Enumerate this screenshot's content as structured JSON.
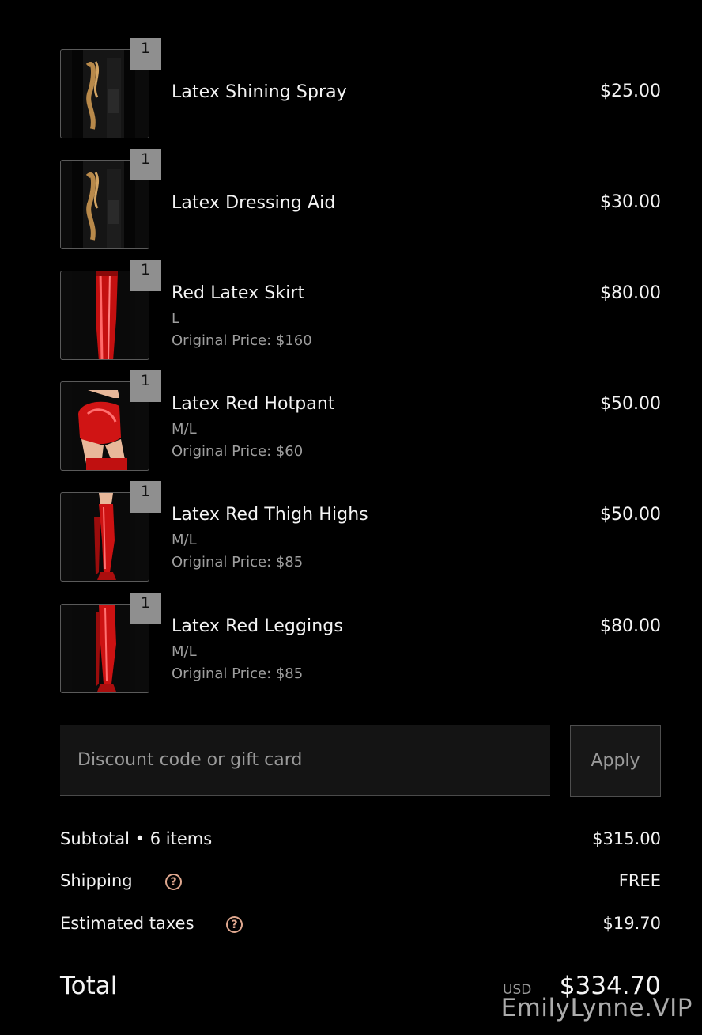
{
  "items": [
    {
      "name": "Latex Shining Spray",
      "qty": "1",
      "price": "$25.00",
      "variant": "",
      "original": "",
      "image": "spray-bottle"
    },
    {
      "name": "Latex Dressing Aid",
      "qty": "1",
      "price": "$30.00",
      "variant": "",
      "original": "",
      "image": "spray-bottle"
    },
    {
      "name": "Red Latex Skirt",
      "qty": "1",
      "price": "$80.00",
      "variant": "L",
      "original": "Original Price: $160",
      "image": "red-skirt"
    },
    {
      "name": "Latex Red Hotpant",
      "qty": "1",
      "price": "$50.00",
      "variant": "M/L",
      "original": "Original Price: $60",
      "image": "red-hotpant"
    },
    {
      "name": "Latex Red Thigh Highs",
      "qty": "1",
      "price": "$50.00",
      "variant": "M/L",
      "original": "Original Price: $85",
      "image": "red-thigh-highs"
    },
    {
      "name": "Latex Red Leggings",
      "qty": "1",
      "price": "$80.00",
      "variant": "M/L",
      "original": "Original Price: $85",
      "image": "red-leggings"
    }
  ],
  "discount": {
    "placeholder": "Discount code or gift card",
    "apply_label": "Apply"
  },
  "summary": {
    "subtotal_label": "Subtotal • 6 items",
    "subtotal_value": "$315.00",
    "shipping_label": "Shipping",
    "shipping_value": "FREE",
    "taxes_label": "Estimated taxes",
    "taxes_value": "$19.70",
    "total_label": "Total",
    "currency": "USD",
    "total_value": "$334.70"
  },
  "help_icon_glyph": "?",
  "watermark": "EmilyLynne.VIP",
  "colors": {
    "background": "#000000",
    "help_icon": "#e0a88f",
    "qty_badge": "#8f8f8f"
  }
}
